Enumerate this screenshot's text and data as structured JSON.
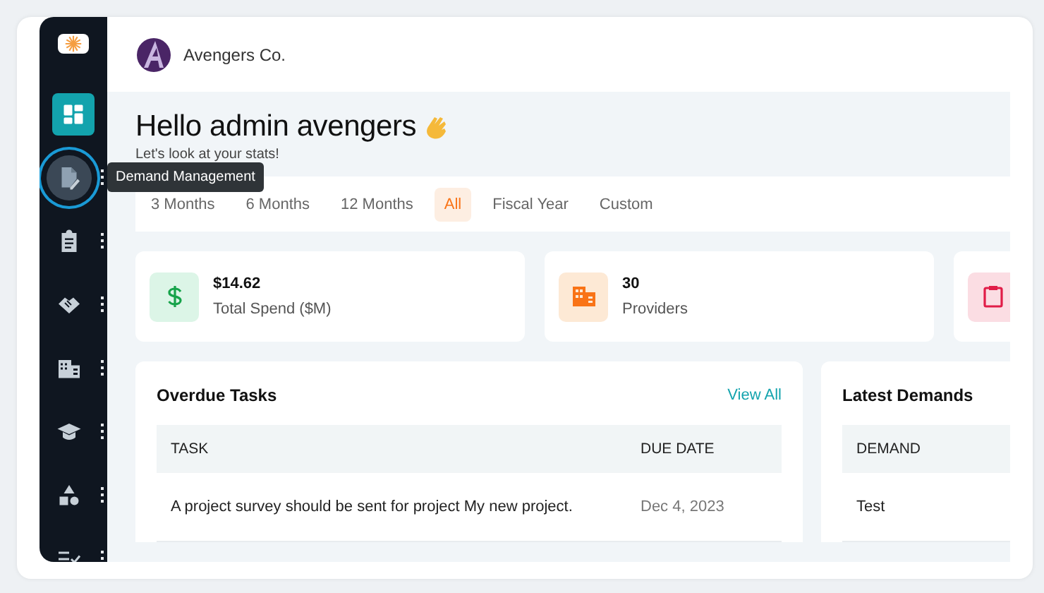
{
  "brand": {
    "name": "Avengers Co."
  },
  "sidebar": {
    "items": [
      {
        "selected": true,
        "hovered": false
      },
      {
        "selected": false,
        "hovered": true
      },
      {
        "selected": false,
        "hovered": false
      },
      {
        "selected": false,
        "hovered": false
      },
      {
        "selected": false,
        "hovered": false
      },
      {
        "selected": false,
        "hovered": false
      },
      {
        "selected": false,
        "hovered": false
      },
      {
        "selected": false,
        "hovered": false
      }
    ]
  },
  "tooltip": {
    "text": "Demand Management"
  },
  "greeting": {
    "title": "Hello admin avengers",
    "subtitle": "Let's look at your stats!"
  },
  "periods": [
    {
      "label": "3 Months",
      "selected": false
    },
    {
      "label": "6 Months",
      "selected": false
    },
    {
      "label": "12 Months",
      "selected": false
    },
    {
      "label": "All",
      "selected": true
    },
    {
      "label": "Fiscal Year",
      "selected": false
    },
    {
      "label": "Custom",
      "selected": false
    }
  ],
  "stats": [
    {
      "value": "$14.62",
      "label": "Total Spend ($M)",
      "color": "#16a34a"
    },
    {
      "value": "30",
      "label": "Providers",
      "color": "#f97316"
    },
    {
      "color": "#e11d48"
    }
  ],
  "overdue_tasks": {
    "title": "Overdue Tasks",
    "link": "View All",
    "columns": [
      "TASK",
      "DUE DATE"
    ],
    "rows": [
      [
        "A project survey should be sent for project My new project.",
        "Dec 4, 2023"
      ]
    ]
  },
  "latest_demands": {
    "title": "Latest Demands",
    "columns": [
      "DEMAND"
    ],
    "rows": [
      [
        "Test"
      ]
    ]
  }
}
